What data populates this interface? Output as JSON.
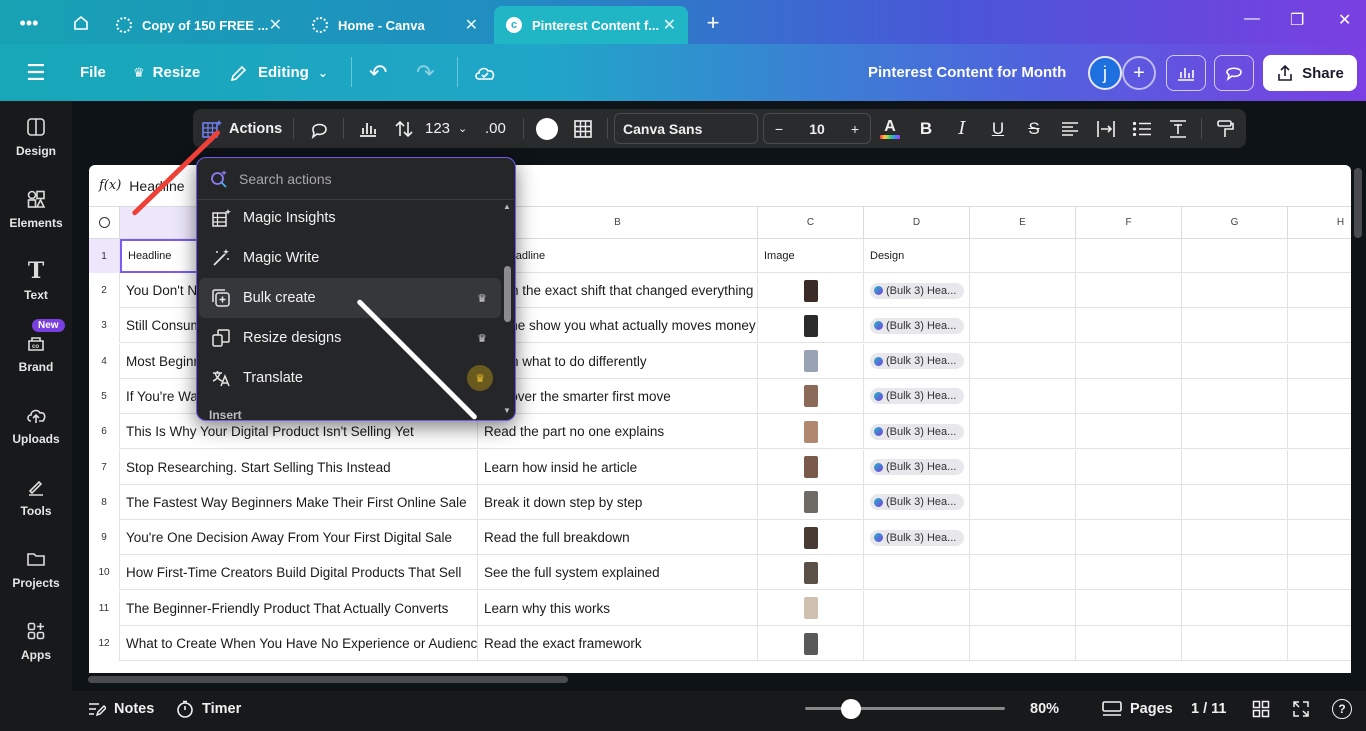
{
  "browser": {
    "tabs": [
      {
        "title": "Copy of 150 FREE ..."
      },
      {
        "title": "Home - Canva"
      },
      {
        "title": "Pinterest Content f..."
      }
    ]
  },
  "header": {
    "file": "File",
    "resize": "Resize",
    "editing": "Editing",
    "doc_title": "Pinterest Content for Month",
    "avatar_initial": "j",
    "share": "Share"
  },
  "sidebar": {
    "items": [
      {
        "label": "Design"
      },
      {
        "label": "Elements"
      },
      {
        "label": "Text"
      },
      {
        "label": "Brand"
      },
      {
        "label": "Uploads"
      },
      {
        "label": "Tools"
      },
      {
        "label": "Projects"
      },
      {
        "label": "Apps"
      }
    ],
    "new_badge": "New"
  },
  "toolbar": {
    "actions": "Actions",
    "number_format": "123",
    "decimal": ".00",
    "font": "Canva Sans",
    "font_size": "10",
    "minus": "−",
    "plus": "+"
  },
  "formula_bar": {
    "fx": "f(x)",
    "value": "Headline"
  },
  "sheet": {
    "columns": [
      "B",
      "C",
      "D",
      "E",
      "F",
      "G",
      "H"
    ],
    "rows": [
      {
        "n": "1",
        "a": "Headline",
        "b": "Subheadline",
        "c": "Image",
        "d": "Design"
      },
      {
        "n": "2",
        "a": "You Don't N",
        "b": "Learn the exact shift that changed everything",
        "d": "(Bulk 3) Hea..."
      },
      {
        "n": "3",
        "a": "Still Consum",
        "b": "Let me show you what actually moves money",
        "d": "(Bulk 3) Hea..."
      },
      {
        "n": "4",
        "a": "Most Beginn",
        "b": "Learn what to do differently",
        "d": "(Bulk 3) Hea..."
      },
      {
        "n": "5",
        "a": "If You're Wa",
        "b": "Discover the smarter first move",
        "d": "(Bulk 3) Hea..."
      },
      {
        "n": "6",
        "a": "This Is Why Your Digital Product Isn't Selling Yet",
        "b": "Read the part no one explains",
        "d": "(Bulk 3) Hea..."
      },
      {
        "n": "7",
        "a": "Stop Researching. Start Selling This Instead",
        "b": "Learn how insid    he article",
        "d": "(Bulk 3) Hea..."
      },
      {
        "n": "8",
        "a": "The Fastest Way Beginners Make Their First Online Sale",
        "b": "Break it down step by step",
        "d": "(Bulk 3) Hea..."
      },
      {
        "n": "9",
        "a": "You're One Decision Away From Your First Digital Sale",
        "b": "Read the full breakdown",
        "d": "(Bulk 3) Hea..."
      },
      {
        "n": "10",
        "a": "How First-Time Creators Build Digital Products That Sell",
        "b": "See the full system explained",
        "d": ""
      },
      {
        "n": "11",
        "a": "The Beginner-Friendly Product That Actually Converts",
        "b": "Learn why this works",
        "d": ""
      },
      {
        "n": "12",
        "a": "What to Create When You Have No Experience or Audience",
        "b": "Read the exact framework",
        "d": ""
      }
    ]
  },
  "actions_menu": {
    "search_placeholder": "Search actions",
    "items": [
      {
        "label": "Magic Insights"
      },
      {
        "label": "Magic Write"
      },
      {
        "label": "Bulk create"
      },
      {
        "label": "Resize designs"
      },
      {
        "label": "Translate"
      }
    ],
    "section": "Insert"
  },
  "footer": {
    "notes": "Notes",
    "timer": "Timer",
    "zoom": "80%",
    "pages": "Pages",
    "page_count": "1 / 11"
  }
}
